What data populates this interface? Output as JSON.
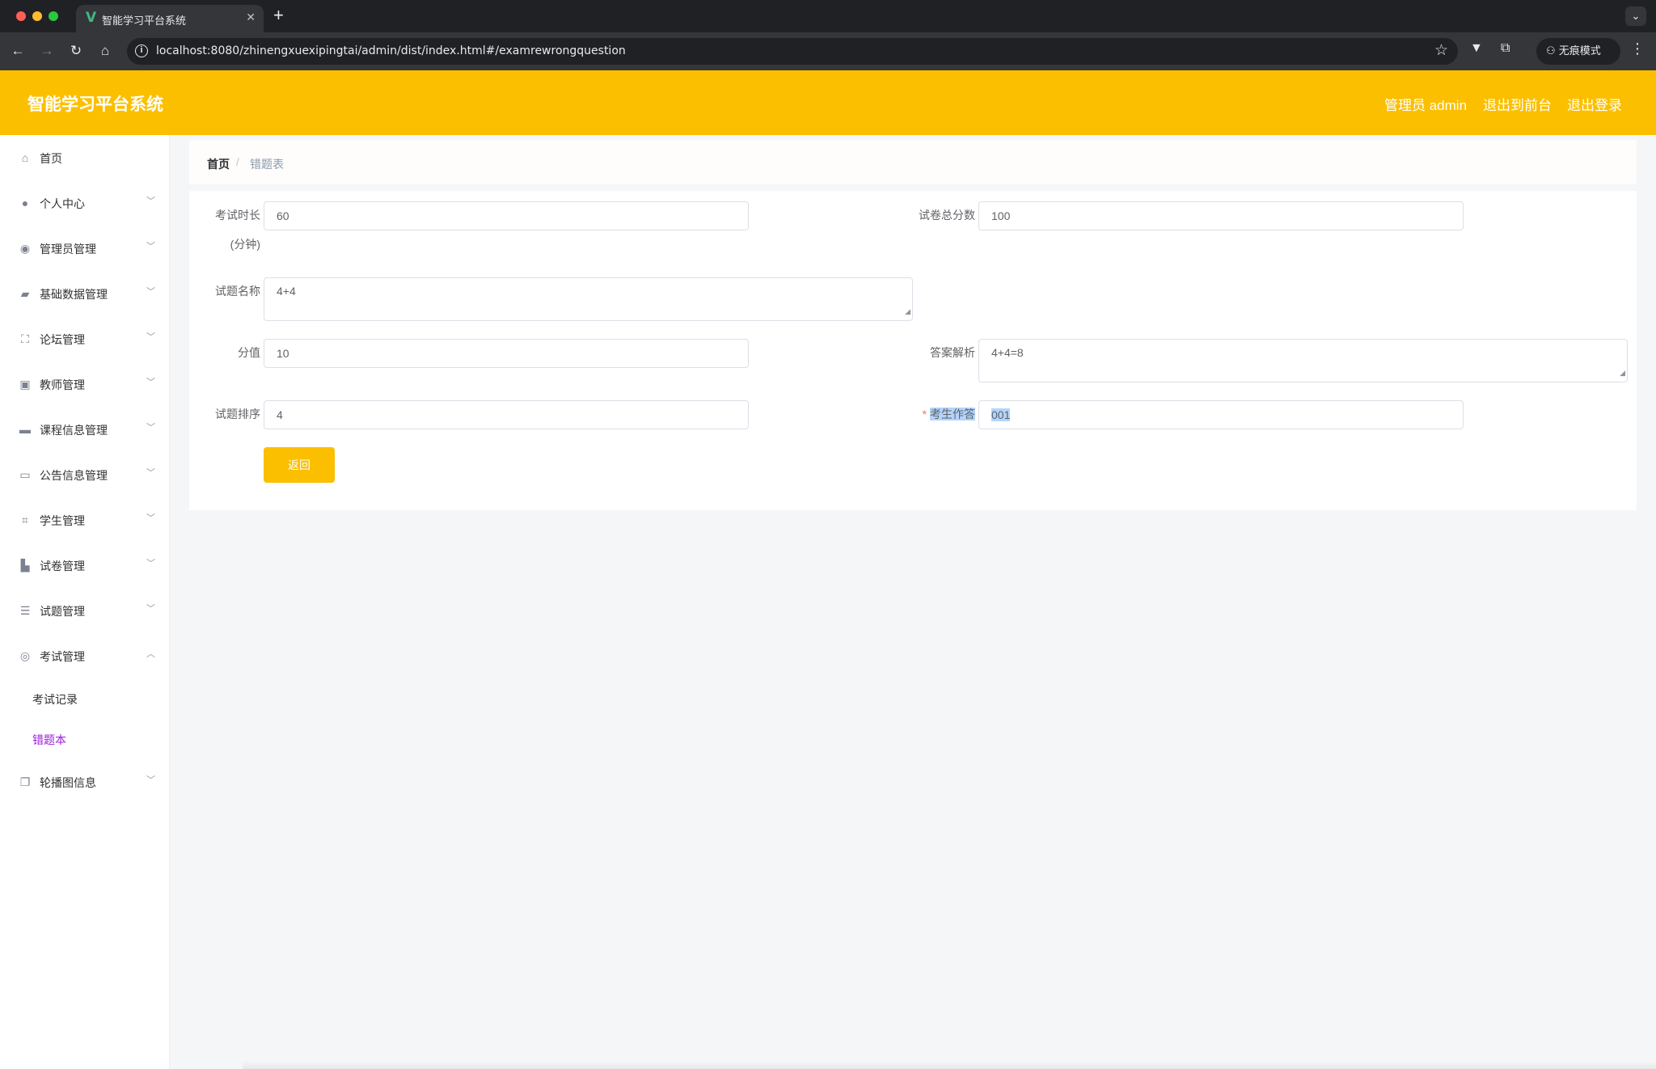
{
  "browser": {
    "tab_title": "智能学习平台系统",
    "tab_favicon": "V",
    "url": "localhost:8080/zhinengxuexipingtai/admin/dist/index.html#/examrewrongquestion",
    "incognito_label": "无痕模式",
    "traffic_colors": [
      "#ff5f57",
      "#febc2e",
      "#28c840"
    ]
  },
  "header": {
    "title": "智能学习平台系统",
    "user_label": "管理员 admin",
    "front_label": "退出到前台",
    "logout_label": "退出登录",
    "accent_color": "#fbbf00"
  },
  "sidebar": {
    "items": [
      {
        "label": "首页",
        "icon": "home-icon"
      },
      {
        "label": "个人中心",
        "icon": "user-icon"
      },
      {
        "label": "管理员管理",
        "icon": "bulb-icon"
      },
      {
        "label": "基础数据管理",
        "icon": "camera-icon"
      },
      {
        "label": "论坛管理",
        "icon": "frame-icon"
      },
      {
        "label": "教师管理",
        "icon": "clipboard-icon"
      },
      {
        "label": "课程信息管理",
        "icon": "monitor-icon"
      },
      {
        "label": "公告信息管理",
        "icon": "card-icon"
      },
      {
        "label": "学生管理",
        "icon": "crop-icon"
      },
      {
        "label": "试卷管理",
        "icon": "chart-icon"
      },
      {
        "label": "试题管理",
        "icon": "list-icon"
      },
      {
        "label": "考试管理",
        "icon": "compass-icon"
      }
    ],
    "sub_items": [
      {
        "label": "考试记录"
      },
      {
        "label": "错题本"
      }
    ],
    "last_item": {
      "label": "轮播图信息",
      "icon": "copy-icon"
    }
  },
  "breadcrumb": {
    "home": "首页",
    "separator": "/",
    "current": "错题表"
  },
  "form": {
    "exam_duration_label": "考试时长(分钟)",
    "exam_duration_value": "60",
    "total_score_label": "试卷总分数",
    "total_score_value": "100",
    "question_name_label": "试题名称",
    "question_name_value": "4+4",
    "score_label": "分值",
    "score_value": "10",
    "analysis_label": "答案解析",
    "analysis_value": "4+4=8",
    "order_label": "试题排序",
    "order_value": "4",
    "student_answer_label": "考生作答",
    "student_answer_value": "001",
    "back_button": "返回"
  }
}
